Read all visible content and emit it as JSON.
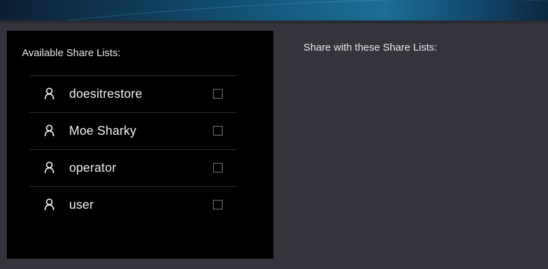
{
  "available": {
    "title": "Available Share Lists:",
    "items": [
      {
        "label": "doesitrestore",
        "icon": "user-icon",
        "checked": false
      },
      {
        "label": "Moe Sharky",
        "icon": "user-icon",
        "checked": false
      },
      {
        "label": "operator",
        "icon": "user-icon",
        "checked": false
      },
      {
        "label": "user",
        "icon": "user-icon",
        "checked": false
      }
    ]
  },
  "selected": {
    "title": "Share with these Share Lists:",
    "items": []
  },
  "colors": {
    "background": "#35343d",
    "panel": "#000000",
    "banner_accent": "#1d6e95"
  }
}
